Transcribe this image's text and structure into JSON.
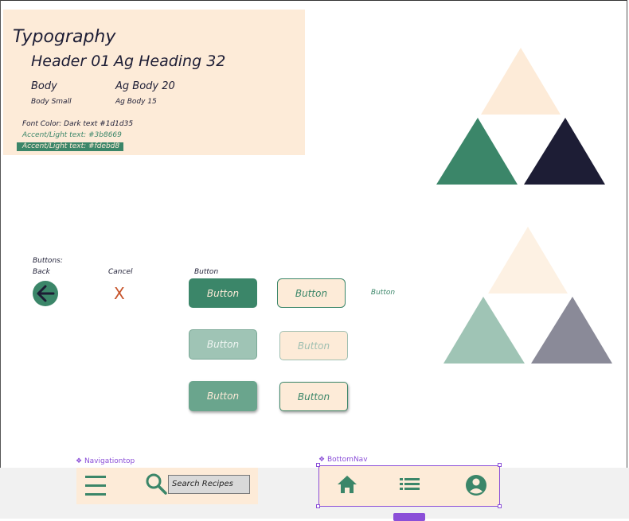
{
  "typography": {
    "title": "Typography",
    "header_label": "Header 01",
    "header_sample": "Ag Heading 32",
    "body_label": "Body",
    "body_sample": "Ag Body 20",
    "body_small_label": "Body Small",
    "body_small_sample": "Ag Body 15",
    "font_color": "Font Color: Dark text #1d1d35",
    "accent_1": "Accent/Light text: #3b8669",
    "accent_2": "Accent/Light text: #fdebd8"
  },
  "palette": {
    "light": "#fdebd8",
    "accent": "#3b8669",
    "dark": "#1d1d35",
    "light_muted": "#fdf1e3",
    "accent_muted": "#9fc4b5",
    "dark_muted": "#8a8a98"
  },
  "buttons": {
    "heading": "Buttons:",
    "back_label": "Back",
    "cancel_label": "Cancel",
    "button_label": "Button",
    "cancel_glyph": "X",
    "primary": "Button",
    "secondary": "Button",
    "text": "Button",
    "primary_disabled": "Button",
    "secondary_disabled": "Button",
    "primary_pressed": "Button",
    "secondary_pressed": "Button"
  },
  "navigation_top": {
    "component_label": "Navigationtop",
    "search_placeholder": "Search Recipes",
    "icons": [
      "menu-icon",
      "search-icon"
    ]
  },
  "bottom_nav": {
    "component_label": "BottomNav",
    "icons": [
      "home-icon",
      "list-icon",
      "account-icon"
    ]
  }
}
